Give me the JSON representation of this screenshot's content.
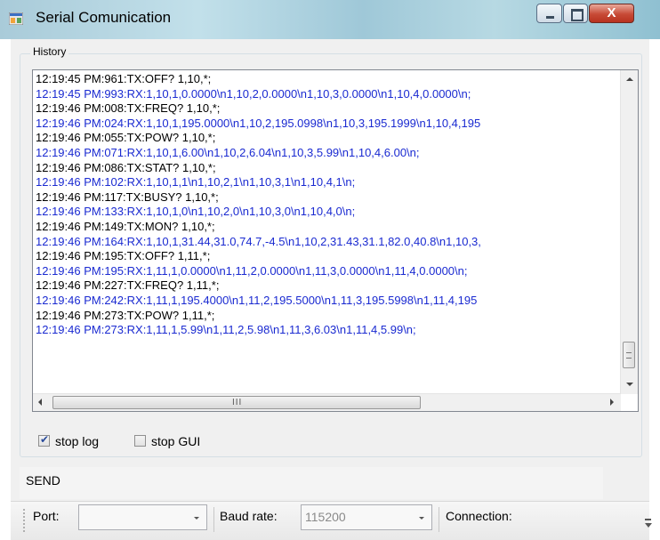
{
  "window": {
    "title": "Serial Comunication",
    "close_glyph": "X"
  },
  "history": {
    "label": "History",
    "lines": [
      {
        "text": "12:19:45 PM:961:TX:OFF? 1,10,*;",
        "kind": "tx"
      },
      {
        "text": "12:19:45 PM:993:RX:1,10,1,0.0000\\n1,10,2,0.0000\\n1,10,3,0.0000\\n1,10,4,0.0000\\n;",
        "kind": "rx"
      },
      {
        "text": "12:19:46 PM:008:TX:FREQ? 1,10,*;",
        "kind": "tx"
      },
      {
        "text": "12:19:46 PM:024:RX:1,10,1,195.0000\\n1,10,2,195.0998\\n1,10,3,195.1999\\n1,10,4,195",
        "kind": "rx"
      },
      {
        "text": "12:19:46 PM:055:TX:POW? 1,10,*;",
        "kind": "tx"
      },
      {
        "text": "12:19:46 PM:071:RX:1,10,1,6.00\\n1,10,2,6.04\\n1,10,3,5.99\\n1,10,4,6.00\\n;",
        "kind": "rx"
      },
      {
        "text": "12:19:46 PM:086:TX:STAT? 1,10,*;",
        "kind": "tx"
      },
      {
        "text": "12:19:46 PM:102:RX:1,10,1,1\\n1,10,2,1\\n1,10,3,1\\n1,10,4,1\\n;",
        "kind": "rx"
      },
      {
        "text": "12:19:46 PM:117:TX:BUSY? 1,10,*;",
        "kind": "tx"
      },
      {
        "text": "12:19:46 PM:133:RX:1,10,1,0\\n1,10,2,0\\n1,10,3,0\\n1,10,4,0\\n;",
        "kind": "rx"
      },
      {
        "text": "12:19:46 PM:149:TX:MON? 1,10,*;",
        "kind": "tx"
      },
      {
        "text": "12:19:46 PM:164:RX:1,10,1,31.44,31.0,74.7,-4.5\\n1,10,2,31.43,31.1,82.0,40.8\\n1,10,3,",
        "kind": "rx"
      },
      {
        "text": "12:19:46 PM:195:TX:OFF? 1,11,*;",
        "kind": "tx"
      },
      {
        "text": "12:19:46 PM:195:RX:1,11,1,0.0000\\n1,11,2,0.0000\\n1,11,3,0.0000\\n1,11,4,0.0000\\n;",
        "kind": "rx"
      },
      {
        "text": "12:19:46 PM:227:TX:FREQ? 1,11,*;",
        "kind": "tx"
      },
      {
        "text": "12:19:46 PM:242:RX:1,11,1,195.4000\\n1,11,2,195.5000\\n1,11,3,195.5998\\n1,11,4,195",
        "kind": "rx"
      },
      {
        "text": "12:19:46 PM:273:TX:POW? 1,11,*;",
        "kind": "tx"
      },
      {
        "text": "12:19:46 PM:273:RX:1,11,1,5.99\\n1,11,2,5.98\\n1,11,3,6.03\\n1,11,4,5.99\\n;",
        "kind": "rx"
      }
    ],
    "hscroll_grip": "III"
  },
  "options": {
    "stop_log": {
      "label": "stop log",
      "checked": true
    },
    "stop_gui": {
      "label": "stop GUI",
      "checked": false
    }
  },
  "send": {
    "label": "SEND"
  },
  "statusbar": {
    "port_label": "Port:",
    "port_value": "",
    "baud_label": "Baud rate:",
    "baud_value": "115200",
    "connection_label": "Connection:"
  },
  "colors": {
    "tx": "#000000",
    "rx": "#1a2ad1"
  }
}
